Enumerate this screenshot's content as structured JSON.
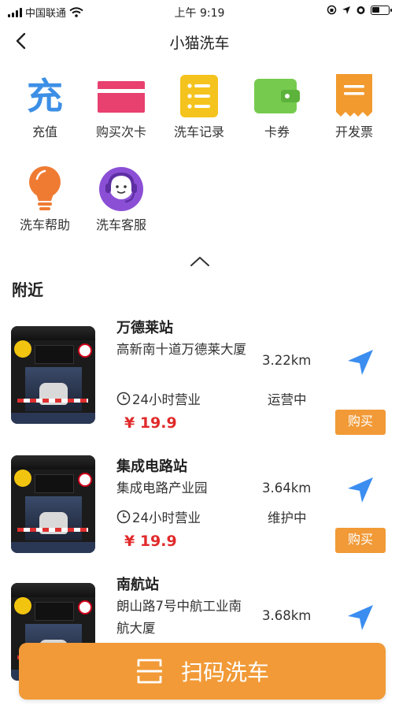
{
  "status_bar": {
    "carrier": "中国联通",
    "time": "上午 9:19"
  },
  "header": {
    "title": "小猫洗车"
  },
  "menu": {
    "items": [
      {
        "label": "充值",
        "icon": "recharge-icon",
        "glyph": "充",
        "color": "#3d8fe6"
      },
      {
        "label": "购买次卡",
        "icon": "card-icon",
        "color": "#e8406f"
      },
      {
        "label": "洗车记录",
        "icon": "list-icon",
        "color": "#f5c31d"
      },
      {
        "label": "卡券",
        "icon": "wallet-icon",
        "color": "#76cb4f"
      },
      {
        "label": "开发票",
        "icon": "invoice-icon",
        "color": "#f29a2e"
      },
      {
        "label": "洗车帮助",
        "icon": "lightbulb-icon",
        "color": "#ef7b33"
      },
      {
        "label": "洗车客服",
        "icon": "customer-service-icon",
        "color": "#8b4fd6"
      }
    ]
  },
  "nearby": {
    "title": "附近",
    "stations": [
      {
        "name": "万德莱站",
        "address": "高新南十道万德莱大厦",
        "distance": "3.22km",
        "hours": "24小时营业",
        "status": "运营中",
        "price": "¥ 19.9",
        "buy_label": "购买"
      },
      {
        "name": "集成电路站",
        "address": "集成电路产业园",
        "distance": "3.64km",
        "hours": "24小时营业",
        "status": "维护中",
        "price": "¥ 19.9",
        "buy_label": "购买"
      },
      {
        "name": "南航站",
        "address": "朗山路7号中航工业南航大厦",
        "distance": "3.68km"
      }
    ]
  },
  "scan_button": {
    "label": "扫码洗车"
  },
  "colors": {
    "accent": "#f19a37",
    "price": "#e12a2a",
    "nav_arrow": "#3b8df0"
  }
}
